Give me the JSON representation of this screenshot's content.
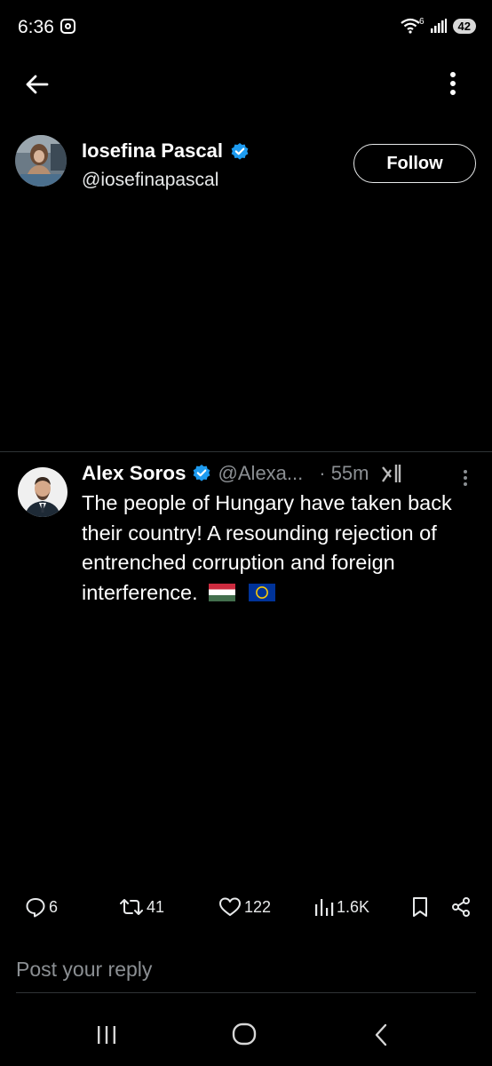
{
  "status_bar": {
    "time": "6:36",
    "battery": "42",
    "network": "6"
  },
  "header": {
    "back_icon": "arrow-left-icon",
    "more_icon": "more-vertical-icon"
  },
  "profile": {
    "name": "Iosefina Pascal",
    "handle": "@iosefinapascal",
    "follow_label": "Follow"
  },
  "tweet": {
    "author": "Alex Soros",
    "handle": "@Alexa...",
    "time": "· 55m",
    "text": "The people of Hungary have taken back their country! A resounding rejection of entrenched corruption and foreign interference.",
    "flags": [
      "🇭🇺",
      "🇪🇺"
    ]
  },
  "actions": {
    "replies": "6",
    "reposts": "41",
    "likes": "122",
    "views": "1.6K"
  },
  "reply_placeholder": "Post your reply",
  "colors": {
    "background": "#000000",
    "verified": "#1d9bf0",
    "divider": "#2f3336",
    "muted": "#8b8f93"
  }
}
